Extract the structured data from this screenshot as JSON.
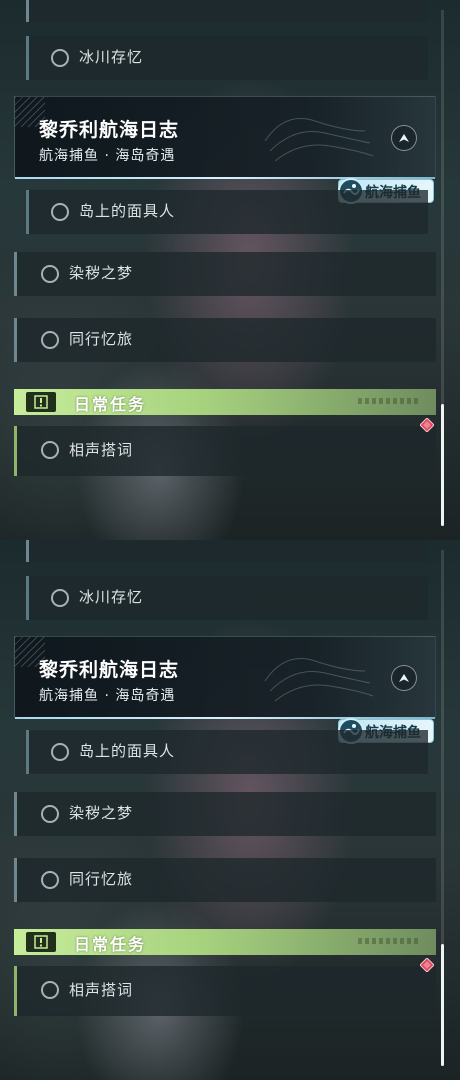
{
  "quests": {
    "glacier": "冰川存忆",
    "island_mask": "岛上的面具人",
    "dream": "染秽之梦",
    "journey": "同行忆旅",
    "crosstalk": "相声搭词"
  },
  "active_quest": {
    "title": "黎乔利航海日志",
    "subtitle": "航海捕鱼 · 海岛奇遇",
    "tag": "航海捕鱼"
  },
  "daily_section": {
    "label": "日常任务"
  },
  "icons": {
    "radio": "radio-circle-icon",
    "track": "navigation-arrow-icon",
    "alert": "alert-diamond-icon",
    "section": "exclamation-icon",
    "tag": "fishing-wave-icon"
  },
  "colors": {
    "daily_accent": "#a6d27e",
    "alert": "#e0445a",
    "tag_bg": "#cdebf4"
  },
  "scrollbar": {
    "position": 0.86
  }
}
